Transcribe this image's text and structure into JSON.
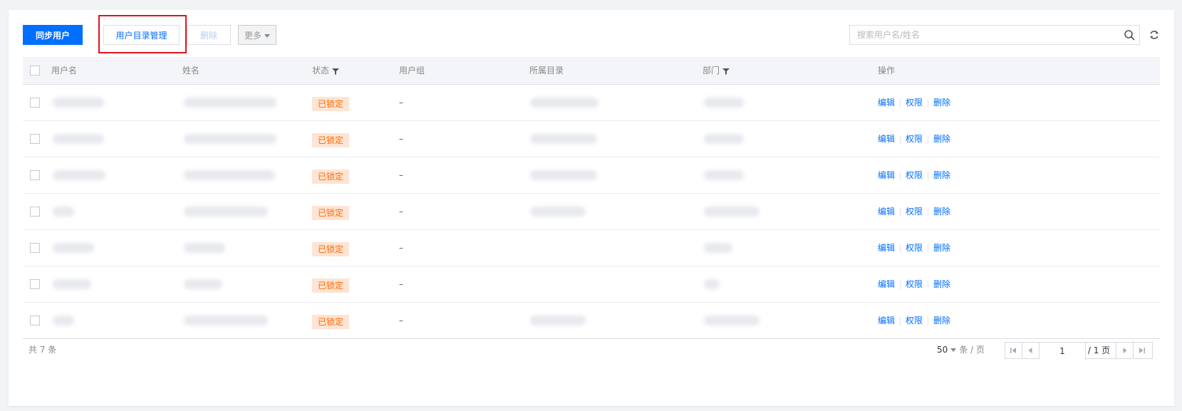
{
  "toolbar": {
    "sync_label": "同步用户",
    "directory_label": "用户目录管理",
    "delete_label": "删除",
    "more_label": "更多",
    "search_placeholder": "搜索用户名/姓名"
  },
  "table": {
    "headers": {
      "username": "用户名",
      "name": "姓名",
      "status": "状态",
      "group": "用户组",
      "directory": "所属目录",
      "department": "部门",
      "actions": "操作"
    },
    "rows": [
      {
        "status": "已锁定",
        "group": "–",
        "edit": "编辑",
        "perm": "权限",
        "del": "删除"
      },
      {
        "status": "已锁定",
        "group": "–",
        "edit": "编辑",
        "perm": "权限",
        "del": "删除"
      },
      {
        "status": "已锁定",
        "group": "–",
        "edit": "编辑",
        "perm": "权限",
        "del": "删除"
      },
      {
        "status": "已锁定",
        "group": "–",
        "edit": "编辑",
        "perm": "权限",
        "del": "删除"
      },
      {
        "status": "已锁定",
        "group": "–",
        "edit": "编辑",
        "perm": "权限",
        "del": "删除"
      },
      {
        "status": "已锁定",
        "group": "–",
        "edit": "编辑",
        "perm": "权限",
        "del": "删除"
      },
      {
        "status": "已锁定",
        "group": "–",
        "edit": "编辑",
        "perm": "权限",
        "del": "删除"
      }
    ]
  },
  "footer": {
    "total": "共 7 条",
    "page_size": "50",
    "page_size_unit": "条 / 页",
    "current_page": "1",
    "total_pages": "/ 1 页"
  },
  "colors": {
    "primary": "#006eff",
    "locked_bg": "#fde4d4",
    "locked_text": "#ff6a00",
    "highlight": "#e0141e"
  }
}
